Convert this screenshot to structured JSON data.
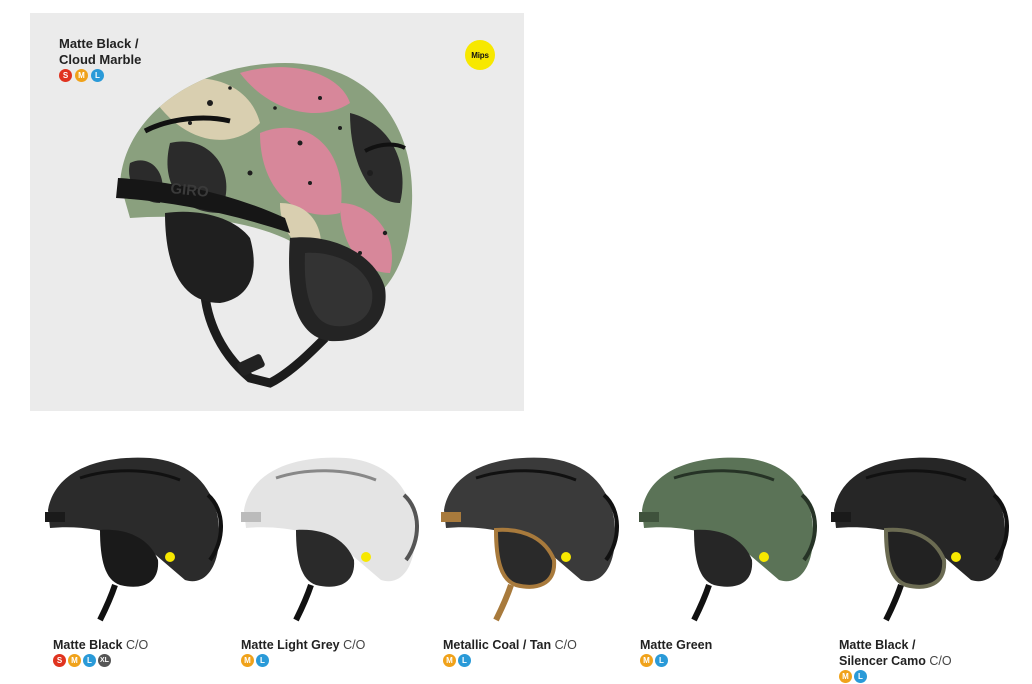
{
  "hero": {
    "name_line1": "Matte Black /",
    "name_line2": "Cloud Marble",
    "sizes": [
      "S",
      "M",
      "L"
    ],
    "badge": "Mips"
  },
  "size_colors": {
    "S": "#e0331f",
    "M": "#f0a21a",
    "L": "#2a9ad8",
    "XL": "#555555"
  },
  "variants": [
    {
      "name": "Matte Black",
      "suffix": "C/O",
      "sizes": [
        "S",
        "M",
        "L",
        "XL"
      ],
      "shell": "#2b2b2b",
      "trim": "#1a1a1a"
    },
    {
      "name": "Matte Light Grey",
      "suffix": "C/O",
      "sizes": [
        "M",
        "L"
      ],
      "shell": "#e4e4e4",
      "trim": "#2a2a2a"
    },
    {
      "name": "Metallic Coal / Tan",
      "suffix": "C/O",
      "sizes": [
        "M",
        "L"
      ],
      "shell": "#3a3a3a",
      "trim": "#a87a3c"
    },
    {
      "name": "Matte Green",
      "suffix": "",
      "sizes": [
        "M",
        "L"
      ],
      "shell": "#5b7357",
      "trim": "#262626"
    },
    {
      "name_line1": "Matte Black /",
      "name": "Silencer Camo",
      "suffix": "C/O",
      "sizes": [
        "M",
        "L"
      ],
      "shell": "#262626",
      "trim": "#6b6b52"
    }
  ]
}
